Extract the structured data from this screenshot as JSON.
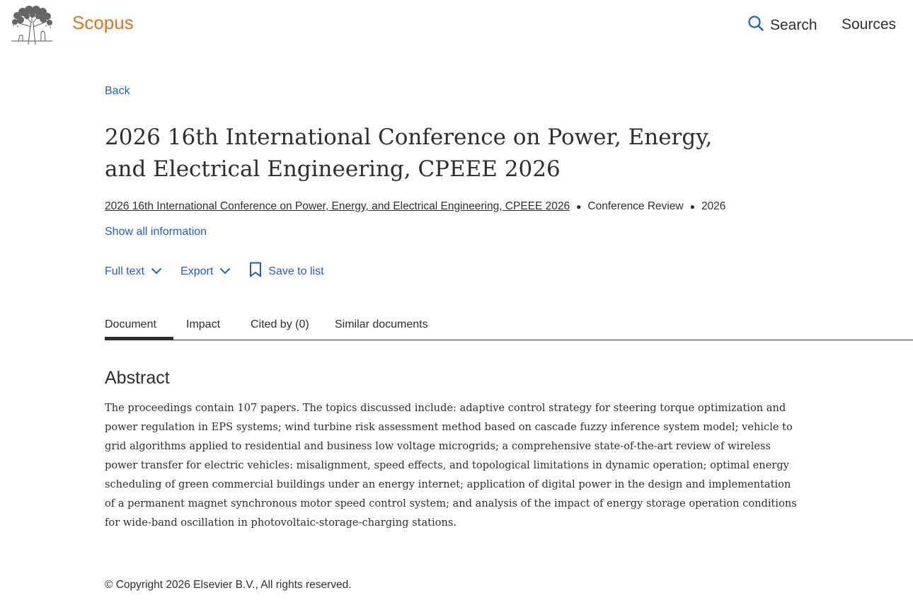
{
  "header": {
    "brand": "Scopus",
    "nav": {
      "search_label": "Search",
      "sources_label": "Sources"
    },
    "brand_color": "#e9711c",
    "link_color": "#1f5bd8"
  },
  "back_label": "Back",
  "document": {
    "title": "2026 16th International Conference on Power, Energy, and Electrical Engineering, CPEEE 2026",
    "source_title": "2026 16th International Conference on Power, Energy, and Electrical Engineering, CPEEE 2026",
    "document_type": "Conference Review",
    "year": "2026",
    "show_all_label": "Show all information"
  },
  "actions": {
    "full_text_label": "Full text",
    "export_label": "Export",
    "save_label": "Save to list"
  },
  "tabs": [
    {
      "label": "Document",
      "active": true
    },
    {
      "label": "Impact",
      "active": false
    },
    {
      "label": "Cited by (0)",
      "active": false
    },
    {
      "label": "Similar documents",
      "active": false
    }
  ],
  "abstract": {
    "heading": "Abstract",
    "text": "The proceedings contain 107 papers. The topics discussed include: adaptive control strategy for steering torque optimization and power regulation in EPS systems; wind turbine risk assessment method based on cascade fuzzy inference system model; vehicle to grid algorithms applied to residential and business low voltage microgrids; a comprehensive state-of-the-art review of wireless power transfer for electric vehicles: misalignment, speed effects, and topological limitations in dynamic operation; optimal energy scheduling of green commercial buildings under an energy internet; application of digital power in the design and implementation of a permanent magnet synchronous motor speed control system; and analysis of the impact of energy storage operation conditions for wide-band oscillation in photovoltaic-storage-charging stations."
  },
  "footer": {
    "copyright": "© Copyright 2026 Elsevier B.V., All rights reserved."
  },
  "icons": [
    "elsevier-tree-logo",
    "search-icon",
    "chevron-down-icon",
    "bookmark-icon"
  ]
}
